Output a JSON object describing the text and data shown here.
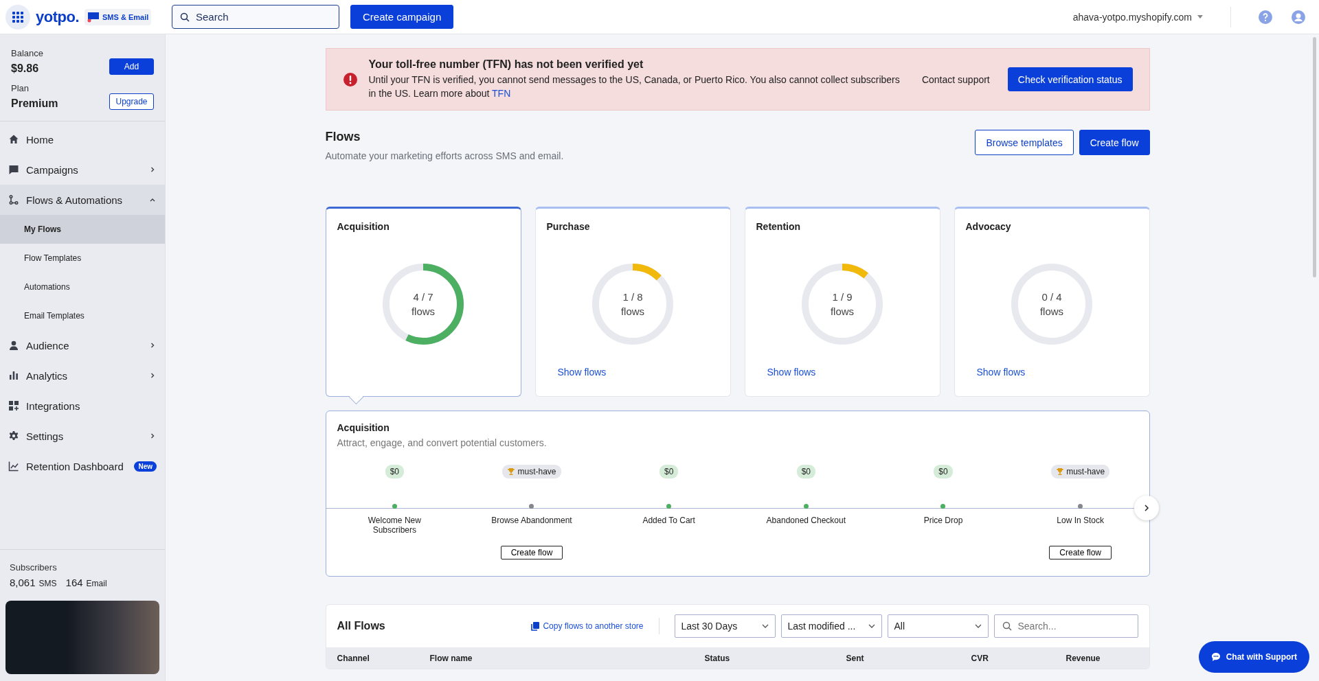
{
  "header": {
    "logo": "yotpo.",
    "product_badge": "SMS & Email",
    "search": {
      "placeholder": "Search"
    },
    "create_button": "Create campaign",
    "store": "ahava-yotpo.myshopify.com"
  },
  "sidebar": {
    "balance_label": "Balance",
    "balance": "$9.86",
    "add_button": "Add",
    "plan_label": "Plan",
    "plan": "Premium",
    "upgrade_button": "Upgrade",
    "items": [
      {
        "label": "Home",
        "chevron": false
      },
      {
        "label": "Campaigns",
        "chevron": true,
        "expanded": false
      },
      {
        "label": "Flows & Automations",
        "chevron": true,
        "expanded": true,
        "children": [
          {
            "label": "My Flows",
            "selected": true
          },
          {
            "label": "Flow Templates",
            "selected": false
          },
          {
            "label": "Automations",
            "selected": false
          },
          {
            "label": "Email Templates",
            "selected": false
          }
        ]
      },
      {
        "label": "Audience",
        "chevron": true,
        "expanded": false
      },
      {
        "label": "Analytics",
        "chevron": true,
        "expanded": false
      },
      {
        "label": "Integrations",
        "chevron": false
      },
      {
        "label": "Settings",
        "chevron": true,
        "expanded": false
      },
      {
        "label": "Retention Dashboard",
        "chevron": false,
        "badge": "New"
      }
    ],
    "subscribers_label": "Subscribers",
    "sms_count": "8,061",
    "sms_label": "SMS",
    "email_count": "164",
    "email_label": "Email"
  },
  "alert": {
    "title": "Your toll-free number (TFN) has not been verified yet",
    "text": "Until your TFN is verified, you cannot send messages to the US, Canada, or Puerto Rico. You also cannot collect subscribers in the US. Learn more about",
    "link": "TFN",
    "contact": "Contact support",
    "button": "Check verification status"
  },
  "page": {
    "title": "Flows",
    "subtitle": "Automate your marketing efforts across SMS and email.",
    "browse_button": "Browse templates",
    "create_button": "Create flow"
  },
  "categories": [
    {
      "name": "Acquisition",
      "count": "4 / 7",
      "unit": "flows",
      "level": 0.571,
      "color": "#4caf62",
      "selected": true
    },
    {
      "name": "Purchase",
      "count": "1 / 8",
      "unit": "flows",
      "level": 0.125,
      "color": "#f0b90b",
      "selected": false,
      "link": "Show flows"
    },
    {
      "name": "Retention",
      "count": "1 / 9",
      "unit": "flows",
      "level": 0.111,
      "color": "#f0b90b",
      "selected": false,
      "link": "Show flows"
    },
    {
      "name": "Advocacy",
      "count": "0 / 4",
      "unit": "flows",
      "level": 0,
      "selected": false,
      "link": "Show flows"
    }
  ],
  "detail": {
    "title": "Acquisition",
    "subtitle": "Attract, engage, and convert potential customers.",
    "steps": [
      {
        "kind": "revenue",
        "badge": "$0",
        "active": true,
        "name": "Welcome New Subscribers"
      },
      {
        "kind": "award",
        "badge": "must-have",
        "active": false,
        "name": "Browse Abandonment",
        "button": "Create flow"
      },
      {
        "kind": "revenue",
        "badge": "$0",
        "active": true,
        "name": "Added To Cart"
      },
      {
        "kind": "revenue",
        "badge": "$0",
        "active": true,
        "name": "Abandoned Checkout"
      },
      {
        "kind": "revenue",
        "badge": "$0",
        "active": true,
        "name": "Price Drop"
      },
      {
        "kind": "award",
        "badge": "must-have",
        "active": false,
        "name": "Low In Stock",
        "button": "Create flow"
      }
    ]
  },
  "all_flows": {
    "title": "All Flows",
    "copy_link": "Copy flows to another store",
    "period": "Last 30 Days",
    "sort": "Last modified ...",
    "filter": "All",
    "search": {
      "placeholder": "Search..."
    },
    "columns": [
      "Channel",
      "Flow name",
      "Status",
      "Sent",
      "CVR",
      "Revenue"
    ]
  },
  "chat_button": "Chat with Support"
}
